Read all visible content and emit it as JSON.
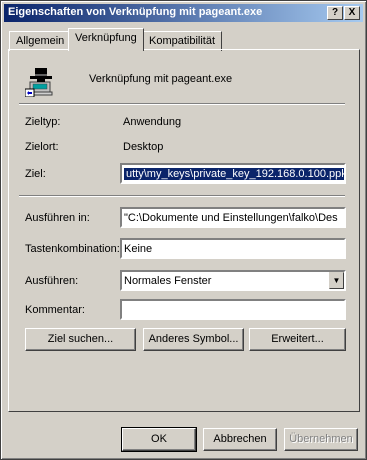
{
  "window": {
    "title": "Eigenschaften von Verknüpfung mit pageant.exe",
    "help_label": "?",
    "close_label": "X"
  },
  "tabs": [
    {
      "label": "Allgemein"
    },
    {
      "label": "Verknüpfung"
    },
    {
      "label": "Kompatibilität"
    }
  ],
  "shortcut": {
    "name": "Verknüpfung mit pageant.exe",
    "icon": "pageant-icon"
  },
  "info": {
    "type_label": "Zieltyp:",
    "type_value": "Anwendung",
    "location_label": "Zielort:",
    "location_value": "Desktop",
    "target_label": "Ziel:",
    "target_value": "utty\\my_keys\\private_key_192.168.0.100.ppk"
  },
  "settings": {
    "run_in_label": "Ausführen in:",
    "run_in_value": "\"C:\\Dokumente und Einstellungen\\falko\\Des",
    "hotkey_label": "Tastenkombination:",
    "hotkey_value": "Keine",
    "run_label": "Ausführen:",
    "run_value": "Normales Fenster",
    "comment_label": "Kommentar:",
    "comment_value": ""
  },
  "buttons": {
    "find_target": "Ziel suchen...",
    "change_icon": "Anderes Symbol...",
    "advanced": "Erweitert...",
    "ok": "OK",
    "cancel": "Abbrechen",
    "apply": "Übernehmen"
  },
  "colors": {
    "title_active": "#0a246a",
    "face": "#d4d0c8",
    "selection": "#0a246a"
  }
}
